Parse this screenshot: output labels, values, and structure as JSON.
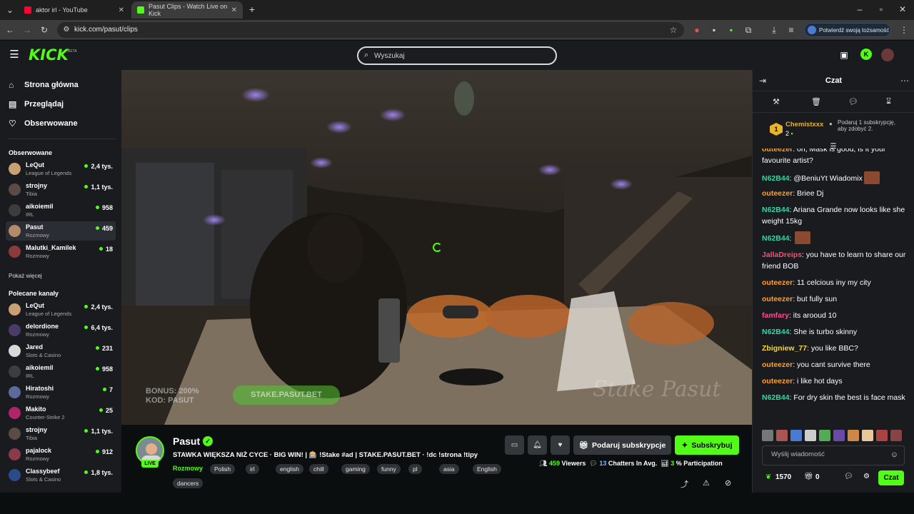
{
  "browser": {
    "tabs": [
      {
        "title": "aktor irl - YouTube",
        "favicon_color": "#ff0033"
      },
      {
        "title": "Pasut Clips - Watch Live on Kick",
        "favicon_color": "#53fc18"
      }
    ],
    "url": "kick.com/pasut/clips",
    "verify_label": "Potwierdź swoją tożsamość"
  },
  "header": {
    "logo": "KICK",
    "beta": "BETA",
    "search_placeholder": "Wyszukaj"
  },
  "sidebar": {
    "nav": [
      {
        "label": "Strona główna",
        "icon": "home-icon"
      },
      {
        "label": "Przeglądaj",
        "icon": "browse-icon"
      },
      {
        "label": "Obserwowane",
        "icon": "heart-icon"
      }
    ],
    "followed_title": "Obserwowane",
    "followed": [
      {
        "name": "LeQut",
        "category": "League of Legends",
        "viewers": "2,4 tys.",
        "color": "#c9a074"
      },
      {
        "name": "strojny",
        "category": "Tibia",
        "viewers": "1,1 tys.",
        "color": "#5a4b46"
      },
      {
        "name": "aikoiemil",
        "category": "IRL",
        "viewers": "958",
        "color": "#3d3d3d"
      },
      {
        "name": "Pasut",
        "category": "Rozmowy",
        "viewers": "459",
        "color": "#b48a6a"
      },
      {
        "name": "Malutki_Kamilek",
        "category": "Rozmowy",
        "viewers": "18",
        "color": "#8a3b3b"
      }
    ],
    "show_more": "Pokaż więcej",
    "recommended_title": "Polecane kanały",
    "recommended": [
      {
        "name": "LeQut",
        "category": "League of Legends",
        "viewers": "2,4 tys.",
        "color": "#c9a074"
      },
      {
        "name": "delordione",
        "category": "Rozmowy",
        "viewers": "6,4 tys.",
        "color": "#4a3b6a"
      },
      {
        "name": "Jared",
        "category": "Slots & Casino",
        "viewers": "231",
        "color": "#d8d8d8"
      },
      {
        "name": "aikoiemil",
        "category": "IRL",
        "viewers": "958",
        "color": "#3d3d3d"
      },
      {
        "name": "Hiratoshi",
        "category": "Rozmowy",
        "viewers": "7",
        "color": "#5a6a9a"
      },
      {
        "name": "Makito",
        "category": "Counter-Strike 2",
        "viewers": "25",
        "color": "#b0246a"
      },
      {
        "name": "strojny",
        "category": "Tibia",
        "viewers": "1,1 tys.",
        "color": "#5a4b46"
      },
      {
        "name": "pajalock",
        "category": "Rozmowy",
        "viewers": "912",
        "color": "#8a3a4a"
      },
      {
        "name": "Classybeef",
        "category": "Slots & Casino",
        "viewers": "1,8 tys.",
        "color": "#2a4a8a"
      }
    ]
  },
  "player": {
    "overlay_bonus": "BONUS: 200%",
    "overlay_code": "KOD: PASUT",
    "overlay_link": "STAKE.PASUT.BET",
    "overlay_watermark": "Stake Pasut"
  },
  "stream": {
    "channel": "Pasut",
    "live": "LIVE",
    "title": "STAWKA WIĘKSZA NIŻ CYCE · BIG WIN! | 🎰 !Stake #ad | STAKE.PASUT.BET · !dc !strona !tipy",
    "category": "Rozmowy",
    "tags": [
      "Polish",
      "irl",
      "english",
      "chill",
      "gaming",
      "funny",
      "pl",
      "asia",
      "English",
      "dancers"
    ],
    "gift_label": "Podaruj subskrypcje",
    "subscribe_label": "Subskrybuj",
    "viewers": "459",
    "viewers_label": "Viewers",
    "chatters": "13",
    "chatters_label": "Chatters In Avg.",
    "participation": "3",
    "participation_label": "% Participation"
  },
  "chat": {
    "title": "Czat",
    "pinned": {
      "rank": "1",
      "user": "Chemistxxx",
      "count": "2",
      "hint": "Podaruj 1 subskrypcję, aby zdobyć 2."
    },
    "messages": [
      {
        "user": "outeezer",
        "color": "#ff9f2e",
        "text": "oh, Mask is good, is it your favourite artist?"
      },
      {
        "user": "N62B44",
        "color": "#2bd9a0",
        "text": "@BeniuYt Wiadomix",
        "emote": true
      },
      {
        "user": "outeezer",
        "color": "#ff9f2e",
        "text": "Briee Dj"
      },
      {
        "user": "N62B44",
        "color": "#2bd9a0",
        "text": "Ariana Grande now looks like she weight 15kg"
      },
      {
        "user": "N62B44",
        "color": "#2bd9a0",
        "text": "",
        "emote": true
      },
      {
        "user": "JallaDreips",
        "color": "#ff4d6d",
        "text": "you have to learn to share our friend BOB"
      },
      {
        "user": "outeezer",
        "color": "#ff9f2e",
        "text": "11 celcious iny my city"
      },
      {
        "user": "outeezer",
        "color": "#ff9f2e",
        "text": "but fully sun"
      },
      {
        "user": "famfary",
        "color": "#ff4d8a",
        "text": "its arooud 10"
      },
      {
        "user": "N62B44",
        "color": "#2bd9a0",
        "text": "She is turbo skinny"
      },
      {
        "user": "Zbigniew_77",
        "color": "#f5d742",
        "text": "you like BBC?"
      },
      {
        "user": "outeezer",
        "color": "#ff9f2e",
        "text": "you cant survive there"
      },
      {
        "user": "outeezer",
        "color": "#ff9f2e",
        "text": "i like hot days"
      },
      {
        "user": "N62B44",
        "color": "#2bd9a0",
        "text": "For dry skin the best is face mask"
      }
    ],
    "input_placeholder": "Wyślij wiadomość",
    "points": "1570",
    "gifts": "0",
    "send_label": "Czat"
  }
}
